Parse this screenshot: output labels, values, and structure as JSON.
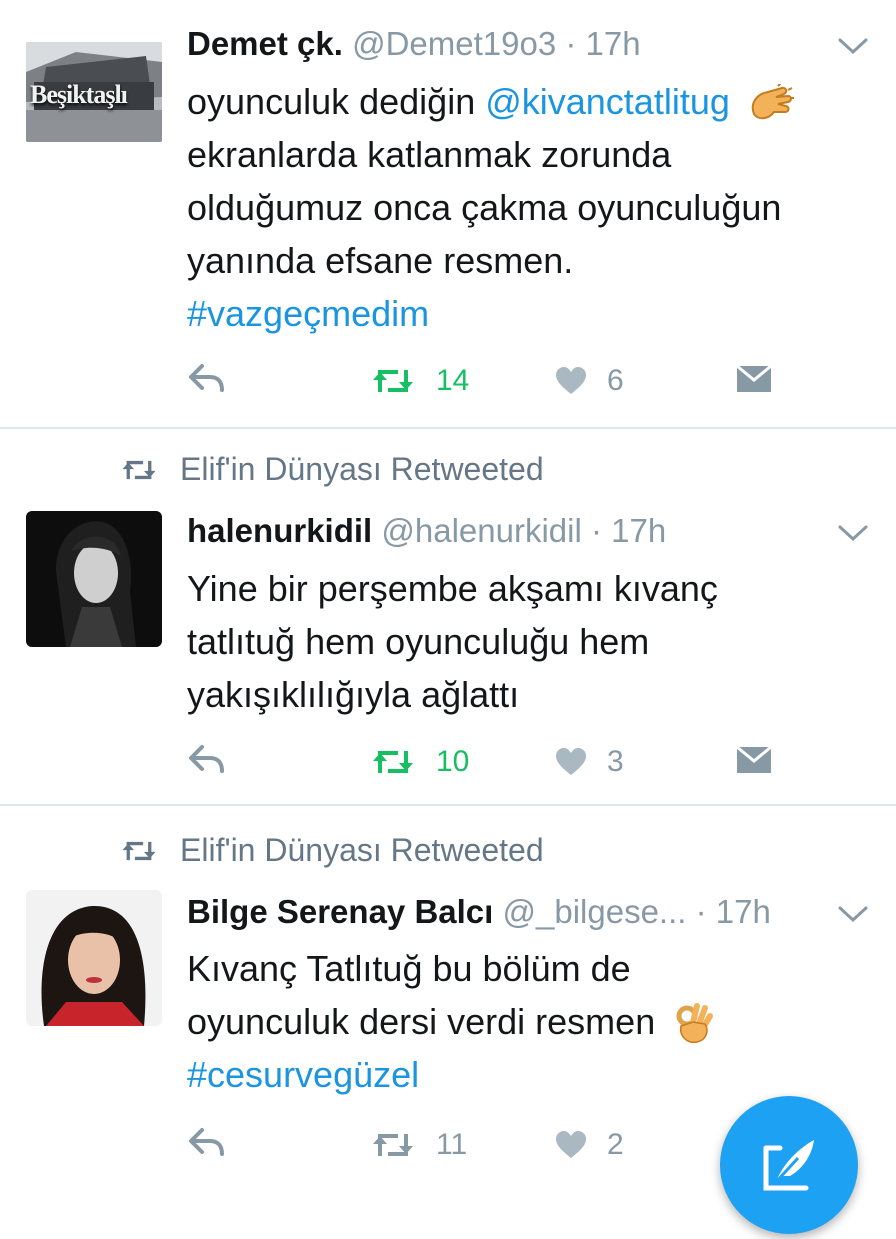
{
  "tweets": [
    {
      "name": "Demet çk.",
      "handle": "@Demet19o3",
      "time": "17h",
      "avatar_text": "Beşiktaşlı",
      "body_parts": [
        "oyunculuk dediğin ",
        "@kivanctatlitug",
        "ekranlarda katlanmak zorunda",
        "olduğumuz onca çakma oyunculuğun",
        "yanında efsane resmen.",
        "#vazgeçmedim"
      ],
      "retweets": "14",
      "likes": "6",
      "retweeted_by_me": true
    },
    {
      "retweet_context": "Elif'in Dünyası Retweeted",
      "name": "halenurkidil",
      "handle": "@halenurkidil",
      "time": "17h",
      "body_parts": [
        "Yine bir perşembe akşamı kıvanç",
        "tatlıtuğ hem oyunculuğu hem",
        "yakışıklılığıyla ağlattı"
      ],
      "retweets": "10",
      "likes": "3",
      "retweeted_by_me": true
    },
    {
      "retweet_context": "Elif'in Dünyası Retweeted",
      "name": "Bilge Serenay Balcı",
      "handle": "@_bilgese...",
      "time": "17h",
      "body_parts": [
        "Kıvanç Tatlıtuğ bu bölüm de",
        "oyunculuk dersi verdi resmen",
        "#cesurvegüzel"
      ],
      "retweets": "11",
      "likes": "2",
      "retweeted_by_me": false
    }
  ],
  "dot": "·",
  "colors": {
    "link": "#1b95e0",
    "retweet_active": "#17bf63",
    "muted": "#8899a6",
    "fab": "#1da1f2"
  }
}
